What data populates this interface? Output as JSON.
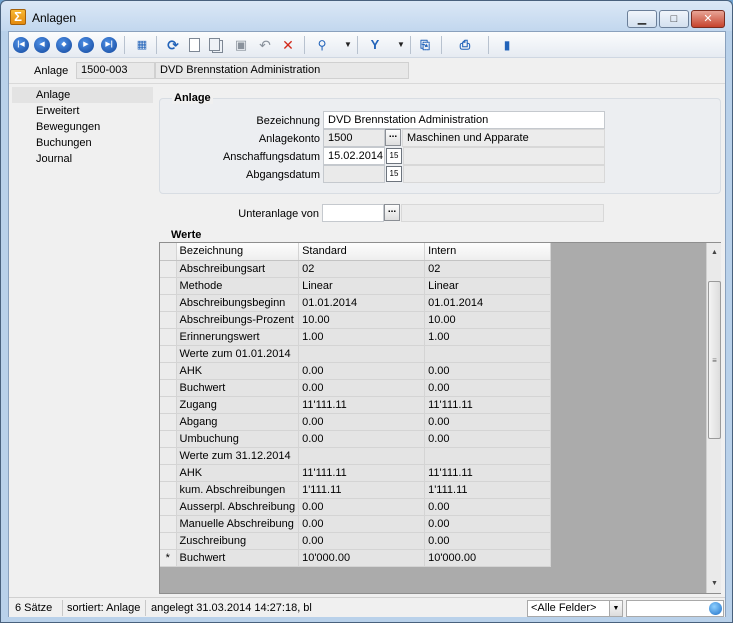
{
  "window": {
    "title": "Anlagen",
    "minimize": "▁",
    "maximize": "□",
    "close": "✕"
  },
  "header": {
    "label": "Anlage",
    "code": "1500-003",
    "name": "DVD Brennstation Administration"
  },
  "sidebar": {
    "items": [
      "Anlage",
      "Erweitert",
      "Bewegungen",
      "Buchungen",
      "Journal"
    ]
  },
  "anlage_group": {
    "title": "Anlage",
    "bezeichnung_label": "Bezeichnung",
    "bezeichnung_value": "DVD Brennstation Administration",
    "konto_label": "Anlagekonto",
    "konto_value": "1500",
    "konto_name": "Maschinen und Apparate",
    "anschaffung_label": "Anschaffungsdatum",
    "anschaffung_value": "15.02.2014",
    "abgang_label": "Abgangsdatum",
    "abgang_value": ""
  },
  "unteranlage": {
    "label": "Unteranlage von",
    "value": ""
  },
  "werte": {
    "title": "Werte",
    "columns": [
      "Bezeichnung",
      "Standard",
      "Intern"
    ],
    "rows": [
      {
        "marker": "",
        "name": "Abschreibungsart",
        "standard": "02",
        "intern": "02"
      },
      {
        "marker": "",
        "name": "Methode",
        "standard": "Linear",
        "intern": "Linear"
      },
      {
        "marker": "",
        "name": "Abschreibungsbeginn",
        "standard": "01.01.2014",
        "intern": "01.01.2014"
      },
      {
        "marker": "",
        "name": "Abschreibungs-Prozent",
        "standard": "10.00",
        "intern": "10.00"
      },
      {
        "marker": "",
        "name": "Erinnerungswert",
        "standard": "1.00",
        "intern": "1.00"
      },
      {
        "marker": "",
        "name": "Werte zum 01.01.2014",
        "standard": "",
        "intern": ""
      },
      {
        "marker": "",
        "name": "AHK",
        "standard": "0.00",
        "intern": "0.00"
      },
      {
        "marker": "",
        "name": "Buchwert",
        "standard": "0.00",
        "intern": "0.00"
      },
      {
        "marker": "",
        "name": "Zugang",
        "standard": "11'111.11",
        "intern": "11'111.11"
      },
      {
        "marker": "",
        "name": "Abgang",
        "standard": "0.00",
        "intern": "0.00"
      },
      {
        "marker": "",
        "name": "Umbuchung",
        "standard": "0.00",
        "intern": "0.00"
      },
      {
        "marker": "",
        "name": "Werte zum 31.12.2014",
        "standard": "",
        "intern": ""
      },
      {
        "marker": "",
        "name": "AHK",
        "standard": "11'111.11",
        "intern": "11'111.11"
      },
      {
        "marker": "",
        "name": "kum. Abschreibungen",
        "standard": "1'111.11",
        "intern": "1'111.11"
      },
      {
        "marker": "",
        "name": "Ausserpl. Abschreibung",
        "standard": "0.00",
        "intern": "0.00"
      },
      {
        "marker": "",
        "name": "Manuelle Abschreibung",
        "standard": "0.00",
        "intern": "0.00"
      },
      {
        "marker": "",
        "name": "Zuschreibung",
        "standard": "0.00",
        "intern": "0.00"
      },
      {
        "marker": "*",
        "name": "Buchwert",
        "standard": "10'000.00",
        "intern": "10'000.00"
      }
    ]
  },
  "statusbar": {
    "count": "6 Sätze",
    "sort": "sortiert: Anlage",
    "created": "angelegt 31.03.2014 14:27:18, bl",
    "filter": "<Alle Felder>"
  },
  "icons": {
    "first": "⏮",
    "prev": "◀",
    "grid": "▦",
    "refresh": "⟳",
    "undo": "↶",
    "delete": "✕",
    "filter": "Y",
    "dropdown": "▾"
  }
}
